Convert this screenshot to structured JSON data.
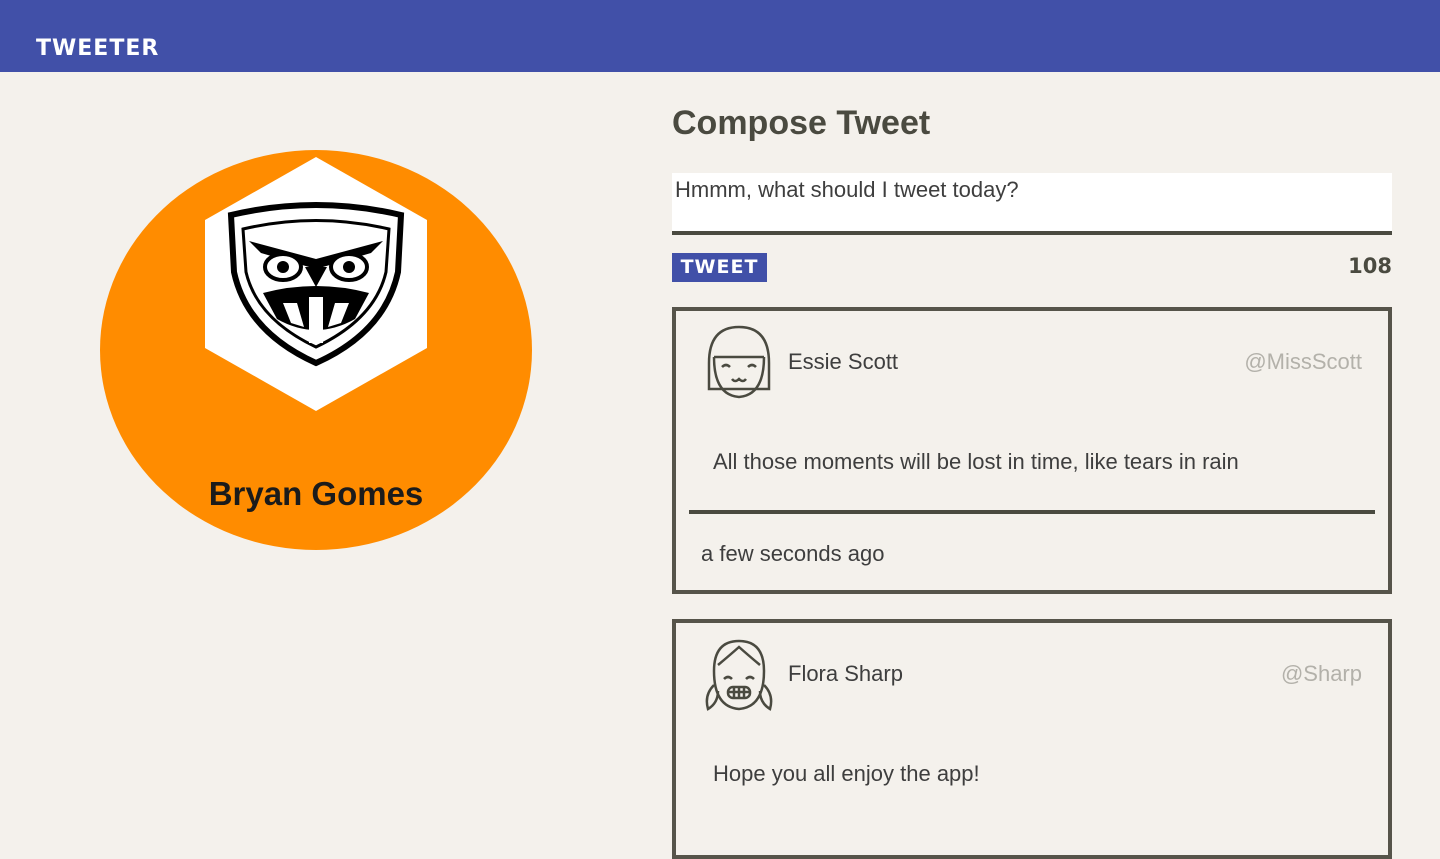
{
  "header": {
    "brand": "TWEETER"
  },
  "colors": {
    "header_bg": "#4150a8",
    "profile_circle": "#ff8c00",
    "page_bg": "#f4f1ec"
  },
  "profile": {
    "name": "Bryan Gomes",
    "logo_icon": "owl-shield-icon"
  },
  "compose": {
    "title": "Compose Tweet",
    "placeholder": "Hmmm, what should I tweet today?",
    "button_label": "TWEET",
    "char_counter": "108"
  },
  "tweets": [
    {
      "avatar_icon": "girl-bangs-avatar-icon",
      "name": "Essie Scott",
      "handle": "@MissScott",
      "text": "All those moments will be lost in time, like tears in rain",
      "time": "a few seconds ago"
    },
    {
      "avatar_icon": "girl-pigtails-avatar-icon",
      "name": "Flora Sharp",
      "handle": "@Sharp",
      "text": "Hope you all enjoy the app!"
    }
  ]
}
